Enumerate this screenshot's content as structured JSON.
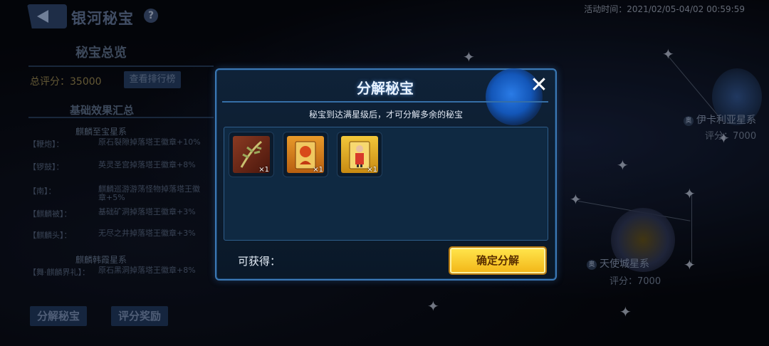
{
  "header": {
    "title": "银河秘宝",
    "event_time": "活动时间：2021/02/05-04/02 00:59:59"
  },
  "left_panel": {
    "overview_title": "秘宝总览",
    "total_score": "总评分：35000",
    "rank_button": "查看排行榜",
    "effects_title": "基础效果汇总",
    "groups": [
      {
        "name": "麒麟至宝星系",
        "effects": [
          {
            "key": "【鞭炮】：",
            "value": "原石裂隙掉落塔王徽章+10%"
          },
          {
            "key": "【锣鼓】：",
            "value": "英灵圣宫掉落塔王徽章+8%"
          },
          {
            "key": "【南】：",
            "value": "麒麟巡游游荡怪物掉落塔王徽章+5%"
          },
          {
            "key": "【麒麟被】：",
            "value": "基础矿洞掉落塔王徽章+3%"
          },
          {
            "key": "【麒麟头】：",
            "value": "无尽之井掉落塔王徽章+3%"
          }
        ]
      },
      {
        "name": "麒麟韩霞星系",
        "effects": [
          {
            "key": "【舞·麒麟界礼】：",
            "value": "原石黑洞掉落塔王徽章+8%"
          }
        ]
      }
    ],
    "decompose_button": "分解秘宝",
    "reward_button": "评分奖励"
  },
  "background_systems": [
    {
      "name": "伊卡利亚星系",
      "score": "评分：7000"
    },
    {
      "name": "天使城星系",
      "score": "评分：7000"
    }
  ],
  "modal": {
    "title": "分解秘宝",
    "hint": "秘宝到达满星级后，才可分解多余的秘宝",
    "items": [
      {
        "icon": "herb-item-icon",
        "qty": "×1",
        "color": "#7a2a1a"
      },
      {
        "icon": "dragon-card-item-icon",
        "qty": "×1",
        "color": "#c8781c"
      },
      {
        "icon": "warrior-card-item-icon",
        "qty": "×1",
        "color": "#d8a018"
      }
    ],
    "reward_label": "可获得：",
    "confirm_button": "确定分解"
  },
  "colors": {
    "accent_blue": "#3c78b4",
    "confirm_yellow": "#f3b81a"
  }
}
